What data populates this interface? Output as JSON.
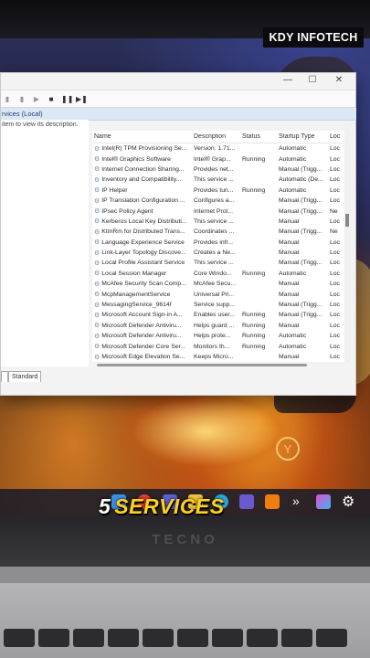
{
  "brand": {
    "watermark": "KDY INFOTECH",
    "device_logo": "TECNO"
  },
  "caption": {
    "number": "5",
    "word": "SERVICES"
  },
  "window": {
    "controls": [
      "—",
      "☐",
      "✕"
    ],
    "scope": "rvices (Local)",
    "left_hint": "item to view its description.",
    "tabs": [
      "",
      "Standard"
    ],
    "columns": {
      "name": "Name",
      "description": "Description",
      "status": "Status",
      "startup": "Startup Type",
      "logon": "Loc"
    },
    "rows": [
      {
        "name": "Intel(R) TPM Provisioning Se...",
        "desc": "Version: 1.71...",
        "status": "",
        "startup": "Automatic",
        "log": "Loc"
      },
      {
        "name": "Intel® Graphics Software",
        "desc": "Intel® Grap...",
        "status": "Running",
        "startup": "Automatic",
        "log": "Loc"
      },
      {
        "name": "Internet Connection Sharing...",
        "desc": "Provides net...",
        "status": "",
        "startup": "Manual (Trigg...",
        "log": "Loc"
      },
      {
        "name": "Inventory and Compatibility...",
        "desc": "This service ...",
        "status": "",
        "startup": "Automatic (De...",
        "log": "Loc"
      },
      {
        "name": "IP Helper",
        "desc": "Provides tun...",
        "status": "Running",
        "startup": "Automatic",
        "log": "Loc"
      },
      {
        "name": "IP Translation Configuration ...",
        "desc": "Configures a...",
        "status": "",
        "startup": "Manual (Trigg...",
        "log": "Loc"
      },
      {
        "name": "IPsec Policy Agent",
        "desc": "Internet Prot...",
        "status": "",
        "startup": "Manual (Trigg...",
        "log": "Ne"
      },
      {
        "name": "Kerberos Local Key Distributi...",
        "desc": "This service ...",
        "status": "",
        "startup": "Manual",
        "log": "Loc"
      },
      {
        "name": "KtmRm for Distributed Trans...",
        "desc": "Coordinates ...",
        "status": "",
        "startup": "Manual (Trigg...",
        "log": "Ne"
      },
      {
        "name": "Language Experience Service",
        "desc": "Provides infr...",
        "status": "",
        "startup": "Manual",
        "log": "Loc"
      },
      {
        "name": "Link-Layer Topology Discove...",
        "desc": "Creates a Ne...",
        "status": "",
        "startup": "Manual",
        "log": "Loc"
      },
      {
        "name": "Local Profile Assistant Service",
        "desc": "This service ...",
        "status": "",
        "startup": "Manual (Trigg...",
        "log": "Loc"
      },
      {
        "name": "Local Session Manager",
        "desc": "Core Windo...",
        "status": "Running",
        "startup": "Automatic",
        "log": "Loc"
      },
      {
        "name": "McAfee Security Scan Comp...",
        "desc": "McAfee Secu...",
        "status": "",
        "startup": "Manual",
        "log": "Loc"
      },
      {
        "name": "McpManagementService",
        "desc": "Universal Pri...",
        "status": "",
        "startup": "Manual",
        "log": "Loc"
      },
      {
        "name": "MessagingService_9614f",
        "desc": "Service supp...",
        "status": "",
        "startup": "Manual (Trigg...",
        "log": "Loc"
      },
      {
        "name": "Microsoft Account Sign-in A...",
        "desc": "Enables user...",
        "status": "Running",
        "startup": "Manual (Trigg...",
        "log": "Loc"
      },
      {
        "name": "Microsoft Defender Antiviru...",
        "desc": "Helps guard ...",
        "status": "Running",
        "startup": "Manual",
        "log": "Loc"
      },
      {
        "name": "Microsoft Defender Antiviru...",
        "desc": "Helps prote...",
        "status": "Running",
        "startup": "Automatic",
        "log": "Loc"
      },
      {
        "name": "Microsoft Defender Core Ser...",
        "desc": "Monitors th...",
        "status": "Running",
        "startup": "Automatic",
        "log": "Loc"
      },
      {
        "name": "Microsoft Edge Elevation Se...",
        "desc": "Keeps Micro...",
        "status": "",
        "startup": "Manual",
        "log": "Loc"
      }
    ]
  },
  "colors": {
    "caption": "#ffd21e",
    "selection": "#dbe7f5"
  },
  "icons": [
    "back-icon",
    "forward-icon",
    "play-icon",
    "stop-icon",
    "pause-icon",
    "restart-icon",
    "gear-icon"
  ]
}
